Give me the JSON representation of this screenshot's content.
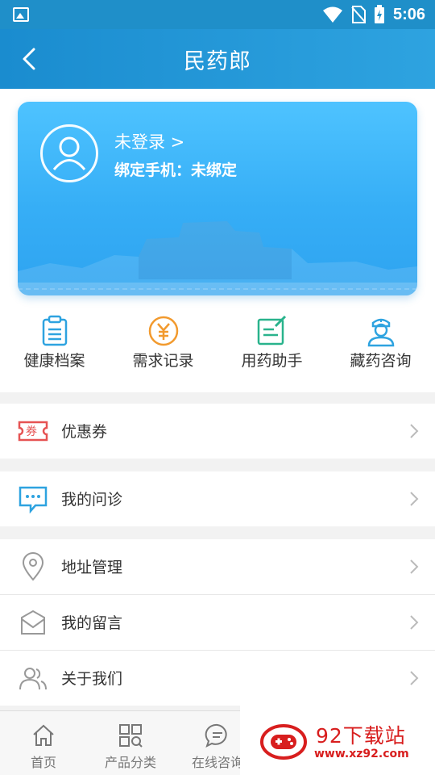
{
  "status_bar": {
    "time": "5:06"
  },
  "nav": {
    "title": "民药郎"
  },
  "profile": {
    "login_text": "未登录  >",
    "phone_text": "绑定手机：未绑定"
  },
  "quick_actions": [
    {
      "label": "健康档案",
      "icon": "clipboard-icon",
      "color": "#2ea3e0"
    },
    {
      "label": "需求记录",
      "icon": "yuan-coin-icon",
      "color": "#f29a2e"
    },
    {
      "label": "用药助手",
      "icon": "pen-note-icon",
      "color": "#29b38c"
    },
    {
      "label": "藏药咨询",
      "icon": "doctor-icon",
      "color": "#2ea3e0"
    }
  ],
  "menu": [
    {
      "label": "优惠券",
      "icon": "coupon-icon",
      "badge": "券"
    },
    {
      "label": "我的问诊",
      "icon": "chat-bubble-icon"
    },
    {
      "label": "地址管理",
      "icon": "location-pin-icon"
    },
    {
      "label": "我的留言",
      "icon": "mail-icon"
    },
    {
      "label": "关于我们",
      "icon": "users-icon"
    }
  ],
  "tabs": [
    {
      "label": "首页",
      "icon": "home-icon"
    },
    {
      "label": "产品分类",
      "icon": "category-grid-icon"
    },
    {
      "label": "在线咨询",
      "icon": "message-icon"
    }
  ],
  "watermark": {
    "name": "92下载站",
    "url": "www.xz92.com"
  },
  "colors": {
    "primary": "#1f8fc9",
    "card": "#36aef6",
    "accent_orange": "#f29a2e",
    "accent_green": "#29b38c",
    "coupon_red": "#e65353"
  }
}
